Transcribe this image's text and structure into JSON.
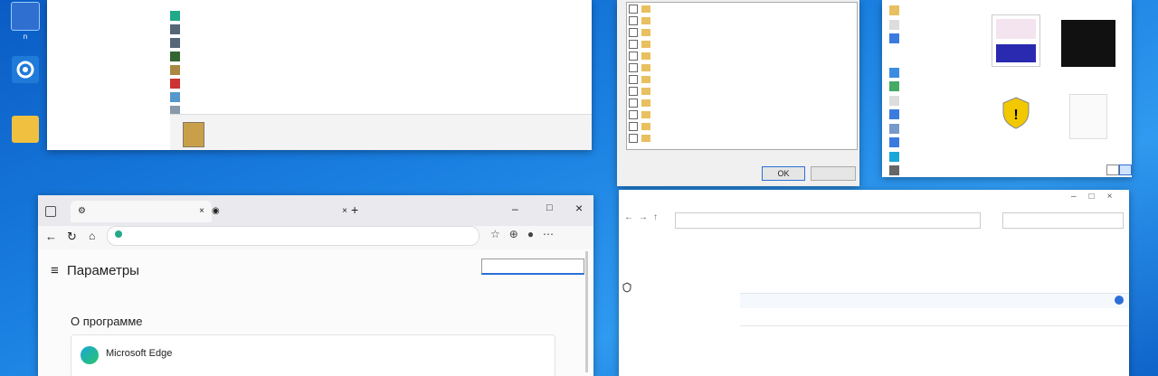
{
  "desktop_icons": [
    {
      "label": "n"
    },
    {
      "label": ""
    },
    {
      "label": ""
    }
  ],
  "programs_window": {
    "rows": [
      {
        "name": "",
        "publisher": "",
        "date": "",
        "size": "",
        "version": ""
      },
      {
        "name": "",
        "publisher": "",
        "date": "",
        "size": "",
        "version": ""
      },
      {
        "name": "",
        "publisher": "",
        "date": "",
        "size": "",
        "version": ""
      },
      {
        "name": "",
        "publisher": "",
        "date": "",
        "size": "",
        "version": ""
      },
      {
        "name": "",
        "publisher": "",
        "date": "",
        "size": "",
        "version": ""
      },
      {
        "name": "",
        "publisher": "",
        "date": "",
        "size": "",
        "version": ""
      },
      {
        "name": "",
        "publisher": "",
        "date": "",
        "size": "",
        "version": ""
      },
      {
        "name": "",
        "publisher": "",
        "date": "",
        "size": "",
        "version": ""
      }
    ],
    "footer_line1": "",
    "footer_line2": ""
  },
  "features_window": {
    "items": [
      "",
      "",
      "",
      "",
      "",
      "",
      "",
      "",
      "",
      "",
      "",
      ""
    ],
    "ok_label": "OK",
    "cancel_label": ""
  },
  "explorer_window": {
    "nav": [
      "",
      "",
      "",
      "",
      "",
      "",
      "",
      "",
      "",
      "",
      ""
    ],
    "thumbs": [
      "",
      "",
      "",
      ""
    ]
  },
  "edge_window": {
    "tab1": "",
    "tab2": "",
    "address": "",
    "page_title": "Параметры",
    "search_placeholder": "",
    "section_title": "О программе",
    "product_name": "Microsoft Edge"
  },
  "cp_window": {
    "title": "",
    "breadcrumb": "",
    "search_placeholder": "",
    "left_links": [
      "",
      "",
      ""
    ],
    "heading": "",
    "description": "",
    "organize": "",
    "col_name": "",
    "col_program": "",
    "col_version": "",
    "group": "",
    "rows": [
      "",
      "",
      ""
    ]
  }
}
